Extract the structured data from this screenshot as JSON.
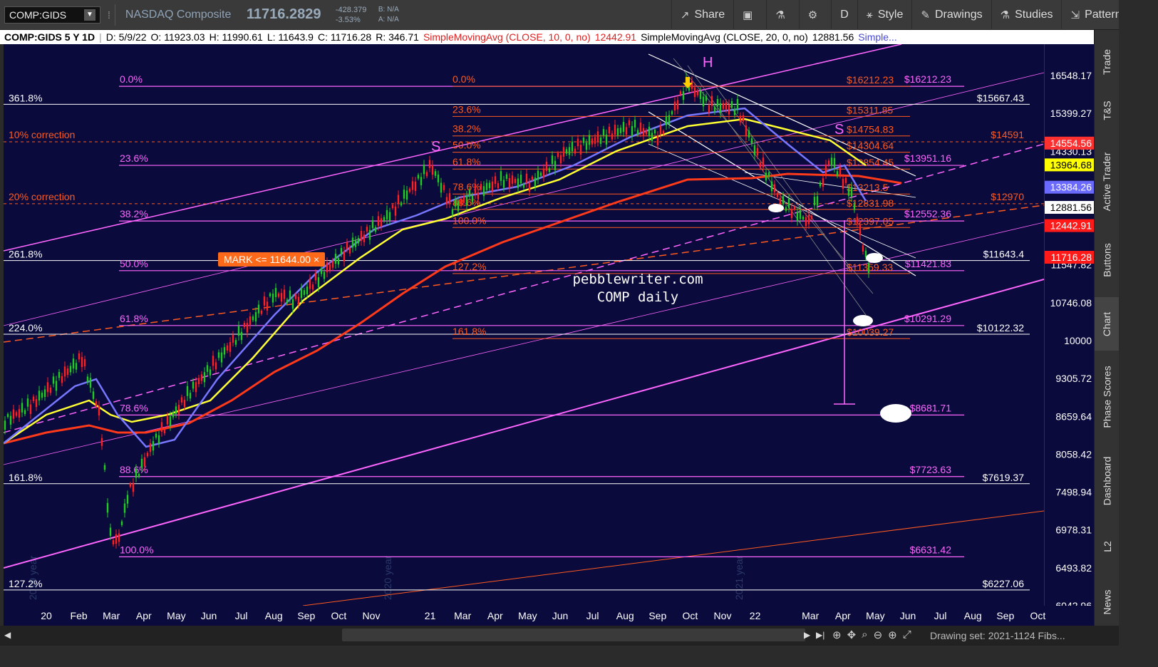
{
  "toolbar": {
    "symbol": "COMP:GIDS",
    "index_name": "NASDAQ Composite",
    "last_price": "11716.2829",
    "net_change": "-428.379",
    "pct_change": "-3.53%",
    "bid": "B: N/A",
    "ask": "A: N/A",
    "share_label": "Share",
    "period_label": "D",
    "style_label": "Style",
    "drawings_label": "Drawings",
    "studies_label": "Studies",
    "patterns_label": "Patterns"
  },
  "infobar": {
    "symbol_period": "COMP:GIDS 5 Y 1D",
    "date": "D: 5/9/22",
    "open": "O: 11923.03",
    "high": "H: 11990.61",
    "low": "L: 11643.9",
    "close": "C: 11716.28",
    "range": "R: 346.71",
    "sma10": "SimpleMovingAvg (CLOSE, 10, 0, no)",
    "sma10_value": "12442.91",
    "sma20": "SimpleMovingAvg (CLOSE, 20, 0, no)",
    "sma20_value": "12881.56",
    "more": "Simple..."
  },
  "sidebar": [
    "Trade",
    "T&S",
    "Active Trader",
    "Buttons",
    "Chart",
    "Phase Scores",
    "Dashboard",
    "L2",
    "News"
  ],
  "price_axis": {
    "ticks": [
      "16548.17",
      "15399.27",
      "14330.13",
      "11547.82",
      "10746.08",
      "10000",
      "9305.72",
      "8659.64",
      "8058.42",
      "7498.94",
      "6978.31",
      "6493.82",
      "6042.96"
    ],
    "bubbles": [
      {
        "value": "14554.56",
        "bg": "#ff3030",
        "fg": "#ffffff"
      },
      {
        "value": "13964.68",
        "bg": "#ffff00",
        "fg": "#000000"
      },
      {
        "value": "13384.26",
        "bg": "#6a6aff",
        "fg": "#ffffff"
      },
      {
        "value": "12881.56",
        "bg": "#ffffff",
        "fg": "#000000"
      },
      {
        "value": "12442.91",
        "bg": "#ff1a1a",
        "fg": "#ffffff"
      },
      {
        "value": "11716.28",
        "bg": "#ff1a1a",
        "fg": "#ffffff"
      }
    ]
  },
  "time_axis": [
    "20",
    "Feb",
    "Mar",
    "Apr",
    "May",
    "Jun",
    "Jul",
    "Aug",
    "Sep",
    "Oct",
    "Nov",
    "21",
    "Mar",
    "Apr",
    "May",
    "Jun",
    "Jul",
    "Aug",
    "Sep",
    "Oct",
    "Nov",
    "22",
    "Mar",
    "Apr",
    "May",
    "Jun",
    "Jul",
    "Aug",
    "Sep",
    "Oct"
  ],
  "year_watermarks": [
    "2019 year",
    "2020 year",
    "2021 year"
  ],
  "levels_left": [
    {
      "label": "361.8%",
      "price": "$15667.43"
    },
    {
      "label": "261.8%",
      "price": "$11643.4"
    },
    {
      "label": "224.0%",
      "price": "$10122.32"
    },
    {
      "label": "161.8%",
      "price": "$7619.37"
    },
    {
      "label": "127.2%",
      "price": "$6227.06"
    }
  ],
  "fib_pink": [
    "0.0%",
    "23.6%",
    "38.2%",
    "50.0%",
    "61.8%",
    "78.6%",
    "88.6%",
    "100.0%"
  ],
  "pink_prices": [
    "$16212.23",
    "$13951.16",
    "$12552.36",
    "$11421.83",
    "$10291.29",
    "$8681.71",
    "$7723.63",
    "$6631.42"
  ],
  "fib_orange": [
    "0.0%",
    "23.6%",
    "38.2%",
    "50.0%",
    "61.8%",
    "78.6%",
    "88.6%",
    "100.0%",
    "127.2%",
    "161.8%"
  ],
  "orange_prices": [
    "$16212.23",
    "$15311.85",
    "$14754.83",
    "$14304.64",
    "$13854.45",
    "$13213.5",
    "$12831.98",
    "$12397.05",
    "$11359.33",
    "$10039.27"
  ],
  "corrections": [
    {
      "label": "10% correction",
      "price": "$14591"
    },
    {
      "label": "20% correction",
      "price": "$12970"
    }
  ],
  "mark_label": "MARK <= 11644.00",
  "mark_close": "×",
  "watermark_line1": "pebblewriter.com",
  "watermark_line2": "COMP daily",
  "hs_labels": [
    "S",
    "H",
    "S"
  ],
  "drawing_set": "Drawing set: 2021-1124 Fibs...",
  "colors": {
    "chart_bg": "#0a0a3c",
    "pink": "#ff66ff",
    "orange": "#ff5a1f",
    "sma_yellow": "#ffff33",
    "sma_blue": "#7777ff"
  }
}
